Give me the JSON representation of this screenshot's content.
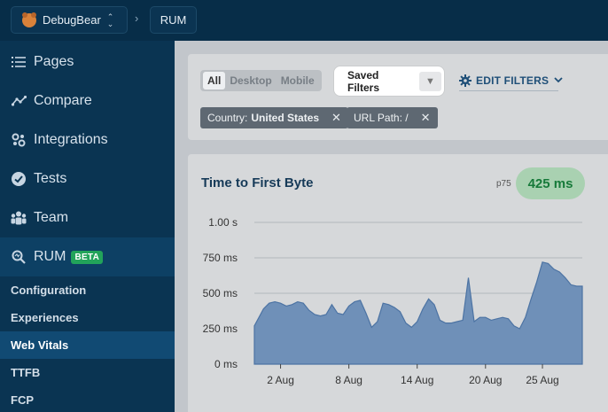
{
  "topbar": {
    "project_label": "DebugBear",
    "separator": "›",
    "section_label": "RUM"
  },
  "sidebar": {
    "items": [
      {
        "label": "Pages",
        "icon": "list-icon"
      },
      {
        "label": "Compare",
        "icon": "compare-icon"
      },
      {
        "label": "Integrations",
        "icon": "integrations-icon"
      },
      {
        "label": "Tests",
        "icon": "check-circle-icon"
      },
      {
        "label": "Team",
        "icon": "team-icon"
      },
      {
        "label": "RUM",
        "icon": "search-icon",
        "badge": "BETA"
      }
    ],
    "subitems": [
      {
        "label": "Configuration"
      },
      {
        "label": "Experiences"
      },
      {
        "label": "Web Vitals"
      },
      {
        "label": "TTFB"
      },
      {
        "label": "FCP"
      }
    ]
  },
  "filters": {
    "device_tabs": [
      "All",
      "Desktop",
      "Mobile"
    ],
    "selected_tab": "All",
    "saved_filters_label": "Saved Filters",
    "edit_filters_label": "EDIT FILTERS",
    "chips": [
      {
        "key": "Country:",
        "value": "United States"
      },
      {
        "key": "URL Path: /",
        "value": ""
      }
    ]
  },
  "metric": {
    "title": "Time to First Byte",
    "percentile": "p75",
    "value": "425 ms"
  },
  "colors": {
    "sidebar_bg": "#0a3452",
    "area_fill": "#6f90b8",
    "area_stroke": "#4c73a3",
    "good_green": "#177a3a"
  },
  "chart_data": {
    "type": "area",
    "title": "",
    "xlabel": "",
    "ylabel": "",
    "ylim": [
      0,
      1000
    ],
    "y_ticks": [
      "0 ms",
      "250 ms",
      "500 ms",
      "750 ms",
      "1.00 s"
    ],
    "y_tick_values": [
      0,
      250,
      500,
      750,
      1000
    ],
    "x_ticks": [
      "2 Aug",
      "8 Aug",
      "14 Aug",
      "20 Aug",
      "25 Aug"
    ],
    "x_tick_days": [
      2,
      8,
      14,
      20,
      25
    ],
    "xlim": [
      -0.3,
      28.5
    ],
    "grid": true,
    "series": [
      {
        "x": [
          -0.3,
          0.5,
          1,
          1.5,
          2,
          2.5,
          3,
          3.5,
          4,
          4.5,
          5,
          5.5,
          6,
          6.5,
          7,
          7.5,
          8,
          8.5,
          9,
          9.5,
          10,
          10.5,
          11,
          11.5,
          12,
          12.5,
          13,
          13.5,
          14,
          14.5,
          15,
          15.5,
          16,
          16.5,
          17,
          17.5,
          18,
          18.5,
          19,
          19.5,
          20,
          20.5,
          21,
          21.5,
          22,
          22.5,
          23,
          23.5,
          24,
          24.5,
          25,
          25.5,
          26,
          26.5,
          27,
          27.5,
          28,
          28.5
        ],
        "values": [
          270,
          390,
          430,
          440,
          430,
          410,
          420,
          440,
          430,
          380,
          350,
          340,
          350,
          420,
          360,
          350,
          410,
          440,
          450,
          360,
          260,
          300,
          430,
          420,
          400,
          370,
          290,
          260,
          300,
          390,
          460,
          420,
          310,
          290,
          290,
          300,
          310,
          610,
          300,
          330,
          330,
          310,
          320,
          330,
          320,
          270,
          250,
          330,
          460,
          580,
          720,
          710,
          670,
          650,
          610,
          560,
          550,
          550
        ]
      }
    ]
  }
}
